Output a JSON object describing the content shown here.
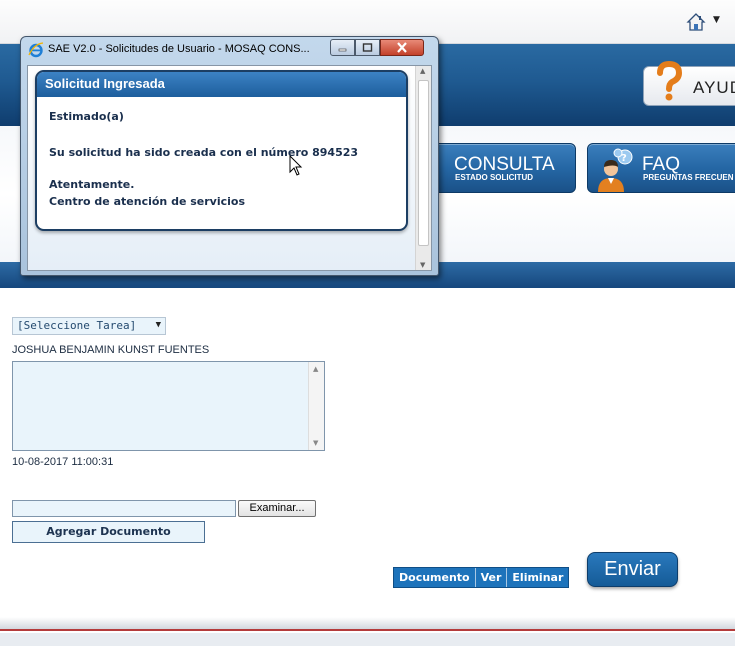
{
  "browser": {
    "home_icon": "home-icon",
    "dropdown_icon": "chevron-down-icon"
  },
  "header": {
    "help_button_label": "AYUD",
    "help_icon": "question-mark-icon",
    "nav": [
      {
        "title": "CONSULTA",
        "subtitle": "ESTADO SOLICITUD"
      },
      {
        "title": "FAQ",
        "subtitle": "PREGUNTAS FRECUEN"
      }
    ]
  },
  "form": {
    "task_select_value": "[Seleccione Tarea]",
    "user_name": "JOSHUA BENJAMIN KUNST FUENTES",
    "comment_value": "",
    "timestamp": "10-08-2017 11:00:31",
    "file_path_value": "",
    "browse_label": "Examinar...",
    "add_document_label": "Agregar Documento",
    "documents_table_headers": [
      "Documento",
      "Ver",
      "Eliminar"
    ],
    "submit_label": "Enviar"
  },
  "popup": {
    "window_title": "SAE V2.0 - Solicitudes de Usuario - MOSAQ CONS...",
    "panel_title": "Solicitud Ingresada",
    "greeting": "Estimado(a)",
    "message": "Su solicitud ha sido creada con el número 894523",
    "closing": "Atentamente.",
    "signature": "Centro de atención de servicios"
  },
  "colors": {
    "header_blue": "#1f5a91",
    "panel_header": "#2b6fae",
    "field_bg": "#e9f4fb",
    "text_dark": "#1a2f4d",
    "close_red": "#c3412a"
  }
}
